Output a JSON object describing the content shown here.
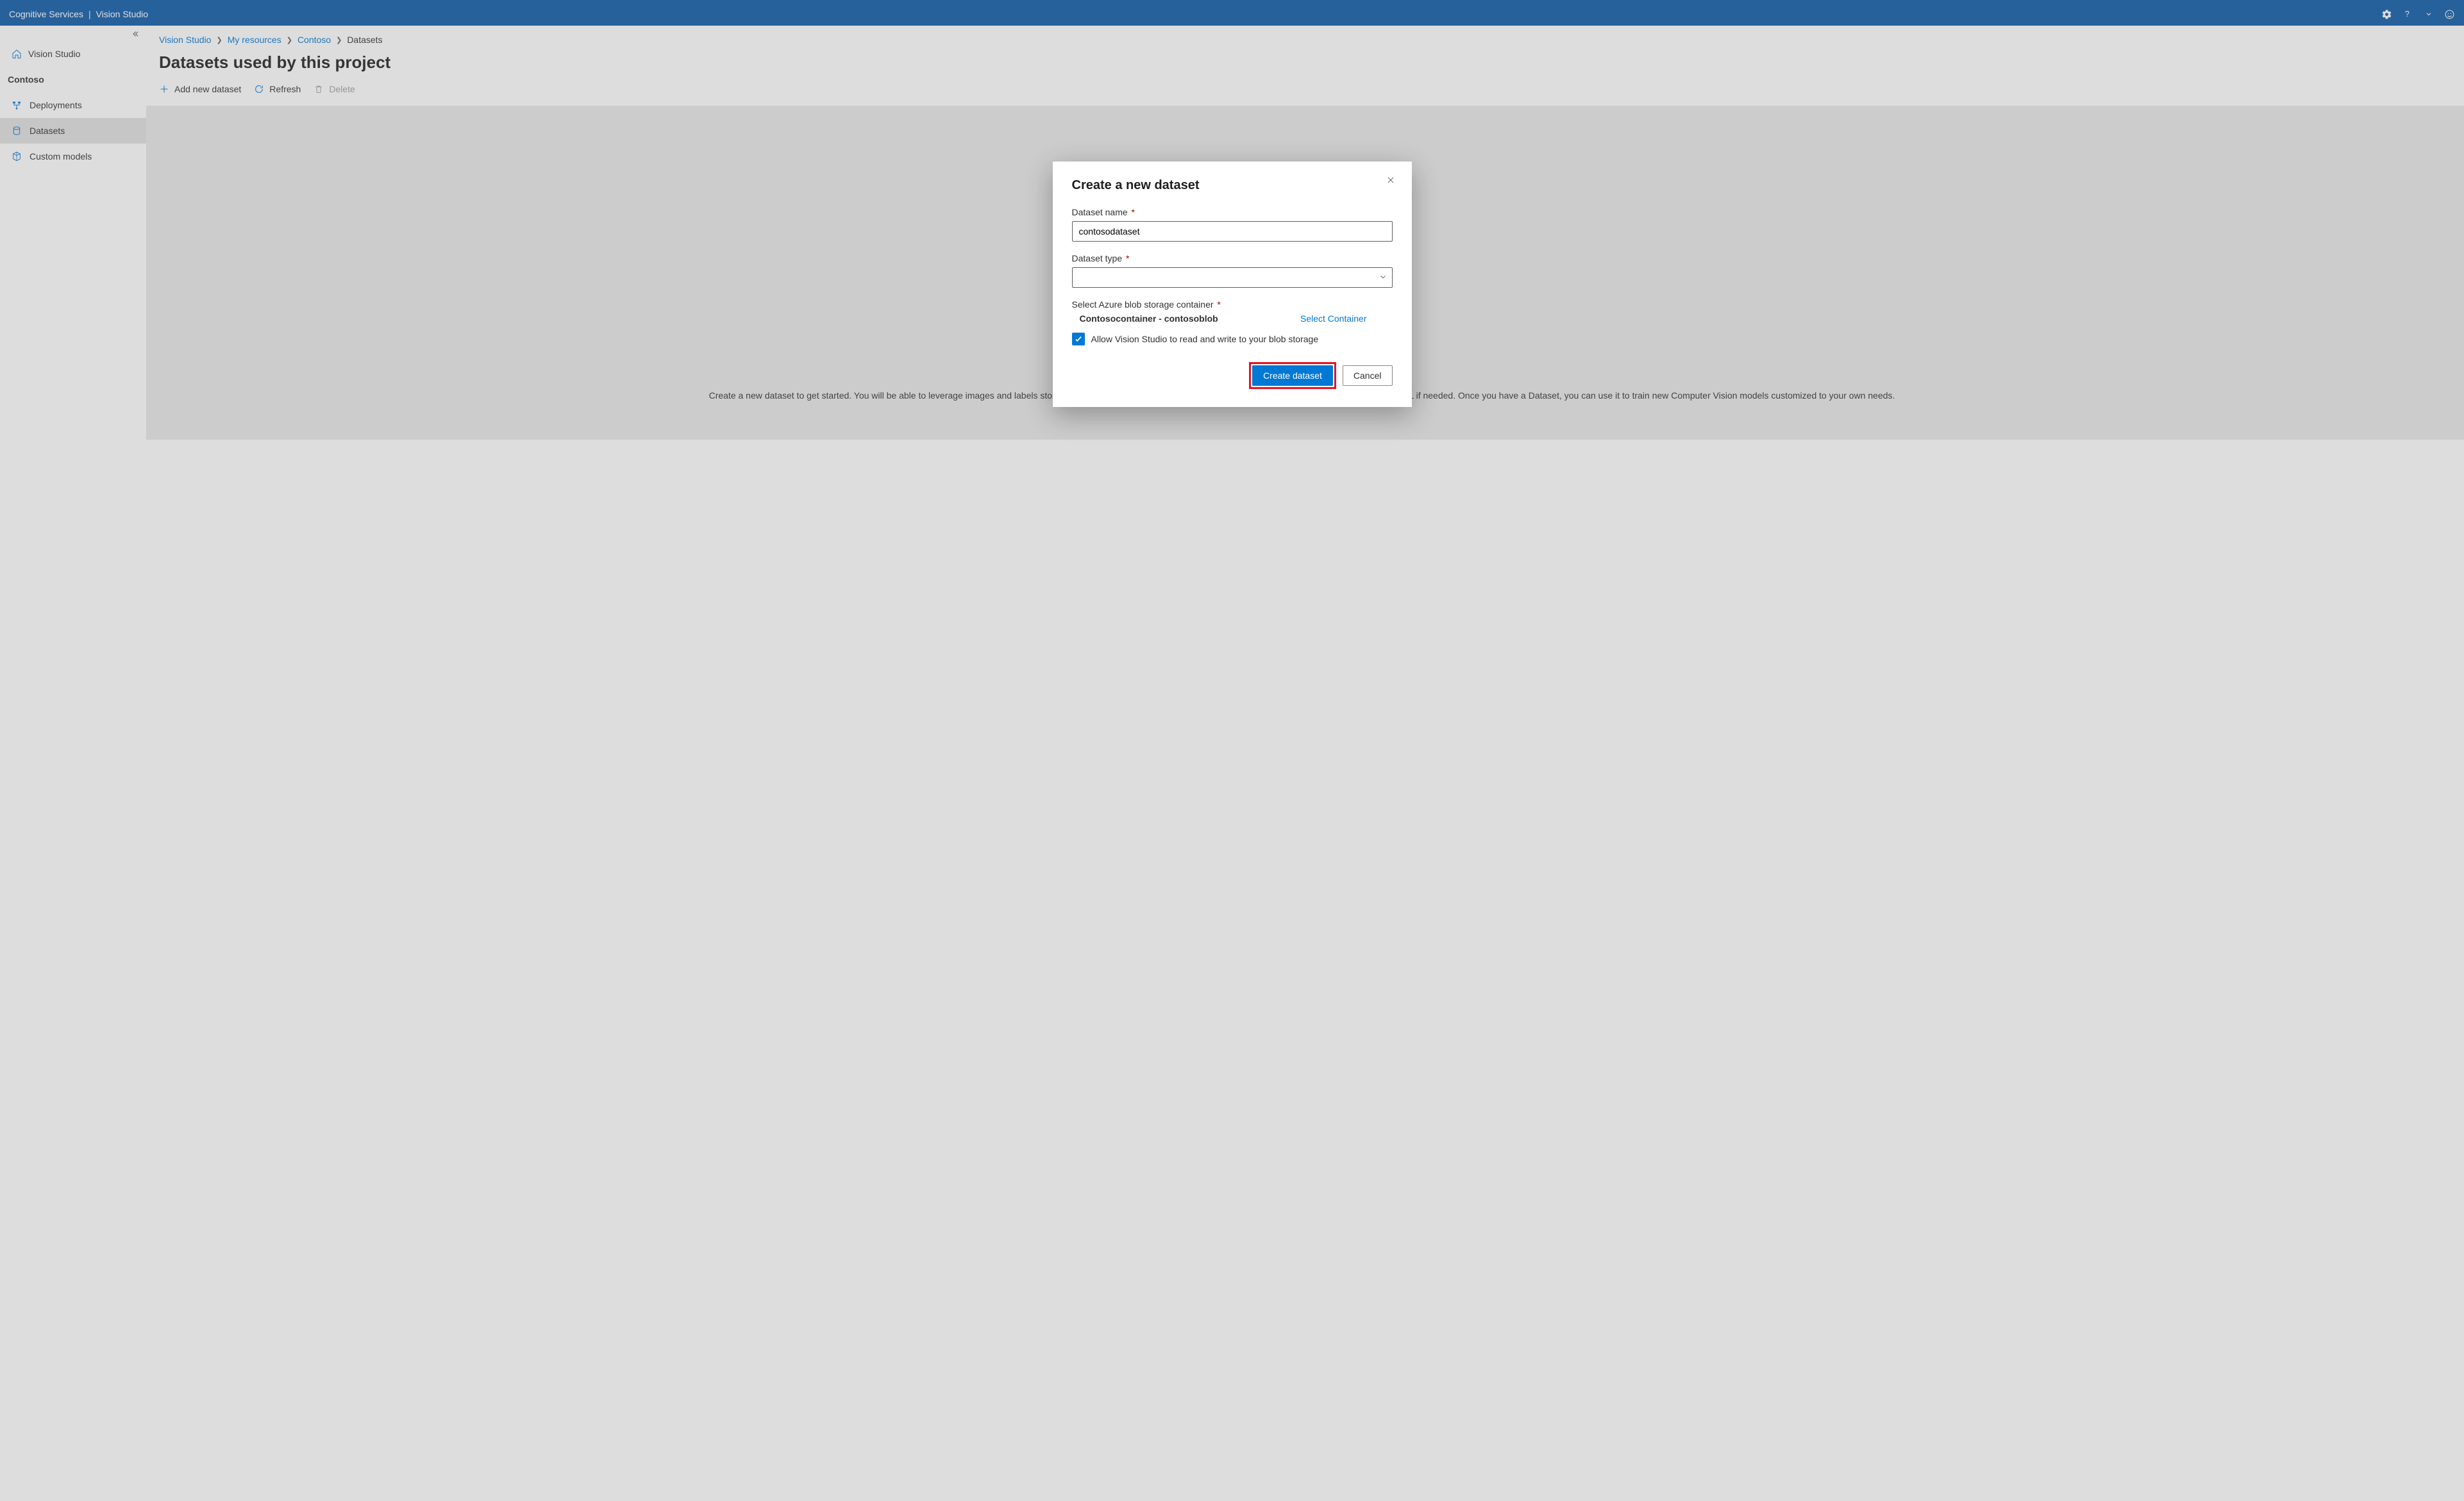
{
  "header": {
    "brand_left": "Cognitive Services",
    "brand_right": "Vision Studio"
  },
  "sidebar": {
    "home_label": "Vision Studio",
    "project_name": "Contoso",
    "items": [
      {
        "icon": "deployments-icon",
        "label": "Deployments",
        "active": false
      },
      {
        "icon": "datasets-icon",
        "label": "Datasets",
        "active": true
      },
      {
        "icon": "models-icon",
        "label": "Custom models",
        "active": false
      }
    ]
  },
  "breadcrumbs": [
    {
      "label": "Vision Studio",
      "current": false
    },
    {
      "label": "My resources",
      "current": false
    },
    {
      "label": "Contoso",
      "current": false
    },
    {
      "label": "Datasets",
      "current": true
    }
  ],
  "page": {
    "title": "Datasets used by this project",
    "toolbar": {
      "add": "Add new dataset",
      "refresh": "Refresh",
      "delete": "Delete"
    },
    "empty_help": "Create a new dataset to get started. You will be able to leverage images and labels stored in your own Azure Blob to create new datasets, as well as label images using Azure ML if needed. Once you have a Dataset, you can use it to train new Computer Vision models customized to your own needs."
  },
  "modal": {
    "title": "Create a new dataset",
    "fields": {
      "name_label": "Dataset name",
      "name_value": "contosodataset",
      "type_label": "Dataset type",
      "type_value": "",
      "container_label": "Select Azure blob storage container",
      "container_value": "Contosocontainer - contosoblob",
      "select_container_link": "Select Container",
      "checkbox_label": "Allow Vision Studio to read and write to your blob storage",
      "checkbox_checked": true
    },
    "buttons": {
      "primary": "Create dataset",
      "secondary": "Cancel"
    }
  }
}
